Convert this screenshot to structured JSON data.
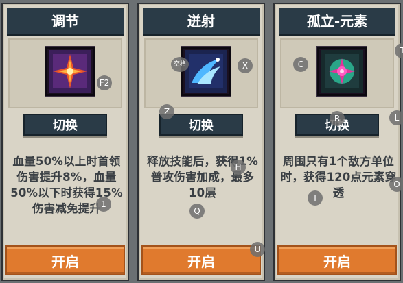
{
  "colors": {
    "title_bg": "#2a3b47",
    "card_bg": "#d9d4c6",
    "open_bg": "#e07a2e",
    "text": "#3a3f44"
  },
  "cards": [
    {
      "title": "调节",
      "icon": "red-star-burst-icon",
      "switch_label": "切换",
      "description": "血量50%以上时首领伤害提升8%，血量50%以下时获得15%伤害减免提升",
      "open_label": "开启"
    },
    {
      "title": "迸射",
      "icon": "blue-wave-icon",
      "switch_label": "切换",
      "description": "释放技能后，获得1%普攻伤害加成，最多10层",
      "open_label": "开启"
    },
    {
      "title": "孤立-元素",
      "icon": "magenta-orb-icon",
      "switch_label": "切换",
      "description": "周围只有1个敌方单位时，获得120点元素穿透",
      "open_label": "开启"
    }
  ],
  "key_hints": [
    "F2",
    "空格",
    "X",
    "Z",
    "H",
    "1",
    "Q",
    "U",
    "C",
    "T",
    "R",
    "L",
    "O",
    "I"
  ]
}
